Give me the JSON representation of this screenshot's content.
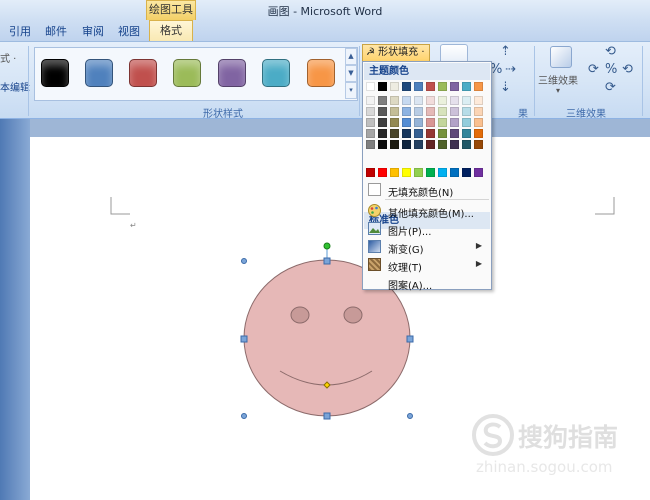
{
  "window": {
    "title": "画图 - Microsoft Word",
    "context_tool": "绘图工具"
  },
  "tabs": [
    {
      "label": "引用"
    },
    {
      "label": "邮件"
    },
    {
      "label": "审阅"
    },
    {
      "label": "视图"
    }
  ],
  "active_tab": "格式",
  "ribbon": {
    "left_partial_top": "式 ·",
    "left_partial_mid": "本编辑",
    "shape_styles_caption": "形状样式",
    "shape_style_colors": [
      "#000000",
      "#4f81bd",
      "#c0504d",
      "#9bbb59",
      "#8064a2",
      "#4bacc6",
      "#f79646"
    ],
    "fill_button_label": "形状填充 ·",
    "effects_partial_caption": "果",
    "three_d_button_label": "三维效果",
    "three_d_caption": "三维效果"
  },
  "fill_menu": {
    "theme_colors_header": "主题颜色",
    "standard_colors_header": "标准色",
    "theme_top_row": [
      "#ffffff",
      "#000000",
      "#eeece1",
      "#1f497d",
      "#4f81bd",
      "#c0504d",
      "#9bbb59",
      "#8064a2",
      "#4bacc6",
      "#f79646"
    ],
    "theme_shades": [
      [
        "#f2f2f2",
        "#7f7f7f",
        "#ddd9c3",
        "#c6d9f0",
        "#dbe5f1",
        "#f2dcdb",
        "#ebf1dd",
        "#e5e0ec",
        "#dbeef3",
        "#fdeada"
      ],
      [
        "#d8d8d8",
        "#595959",
        "#c4bd97",
        "#8db3e2",
        "#b8cce4",
        "#e5b9b7",
        "#d7e3bc",
        "#ccc1d9",
        "#b7dde8",
        "#fbd5b5"
      ],
      [
        "#bfbfbf",
        "#3f3f3f",
        "#938953",
        "#548dd4",
        "#95b3d7",
        "#d99694",
        "#c3d69b",
        "#b2a2c7",
        "#92cddc",
        "#fac08f"
      ],
      [
        "#a5a5a5",
        "#262626",
        "#494429",
        "#17365d",
        "#366092",
        "#953734",
        "#76923c",
        "#5f497a",
        "#31859b",
        "#e36c09"
      ],
      [
        "#7f7f7f",
        "#0c0c0c",
        "#1d1b10",
        "#0f243e",
        "#244061",
        "#632423",
        "#4f6128",
        "#3f3151",
        "#205867",
        "#974806"
      ]
    ],
    "standard_colors": [
      "#c00000",
      "#ff0000",
      "#ffc000",
      "#ffff00",
      "#92d050",
      "#00b050",
      "#00b0f0",
      "#0070c0",
      "#002060",
      "#7030a0"
    ],
    "no_fill": "无填充颜色(N)",
    "more_colors": "其他填充颜色(M)...",
    "picture": "图片(P)...",
    "gradient": "渐变(G)",
    "texture": "纹理(T)",
    "pattern": "图案(A)..."
  },
  "smiley": {
    "fill": "#e6b8b7",
    "stroke": "#8c6b6b"
  },
  "watermark": {
    "title": "搜狗指南",
    "url": "zhinan.sogou.com"
  }
}
